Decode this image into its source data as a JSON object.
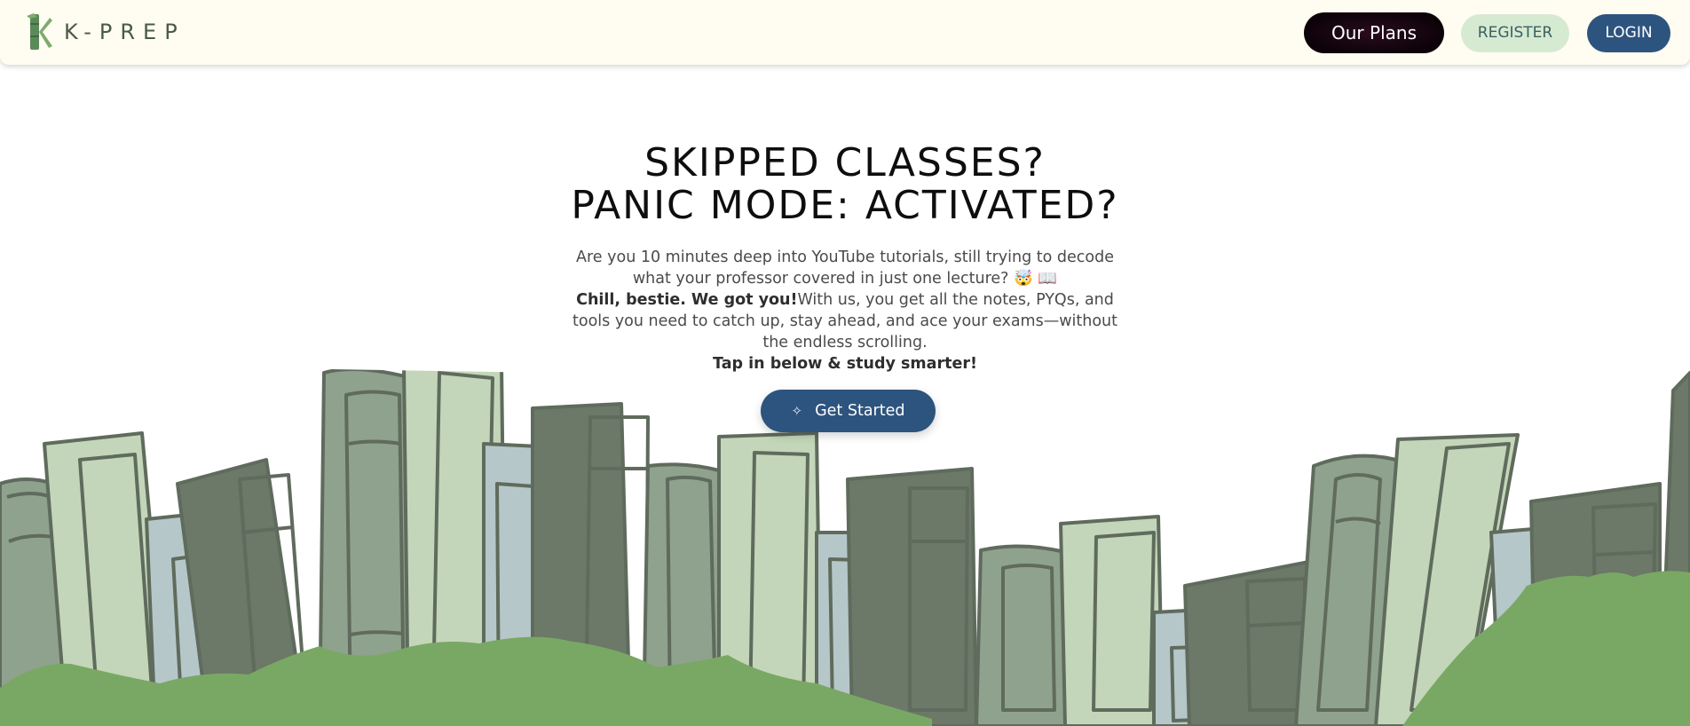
{
  "brand": {
    "name": "K-PREP",
    "icon": "bamboo-k-logo-icon"
  },
  "nav": {
    "plans_label": "Our Plans",
    "register_label": "REGISTER",
    "login_label": "LOGIN"
  },
  "hero": {
    "title_line1": "SKIPPED CLASSES?",
    "title_line2": "PANIC MODE: ACTIVATED?",
    "intro": "Are you 10 minutes deep into YouTube tutorials, still trying to decode what your professor covered in just one lecture? 🤯 📖",
    "bold_lead": "Chill, bestie. We got you!",
    "pitch": "With us, you get all the notes, PYQs, and tools you need to catch up, stay ahead, and ace your exams—without the endless scrolling.",
    "cta_line": "Tap in below & study smarter!",
    "cta_label": "Get Started",
    "cta_icon": "sparkle-icon"
  },
  "colors": {
    "nav_bg": "#fffdf1",
    "primary_blue": "#2d547e",
    "register_bg": "#d6ead2",
    "grass_green": "#79a864",
    "book_dark": "#6c7868",
    "book_sage": "#8fa28d",
    "book_light": "#c3d6b9",
    "book_blue": "#b6c7ca"
  },
  "illustration": "bookshelf-with-green-grass"
}
